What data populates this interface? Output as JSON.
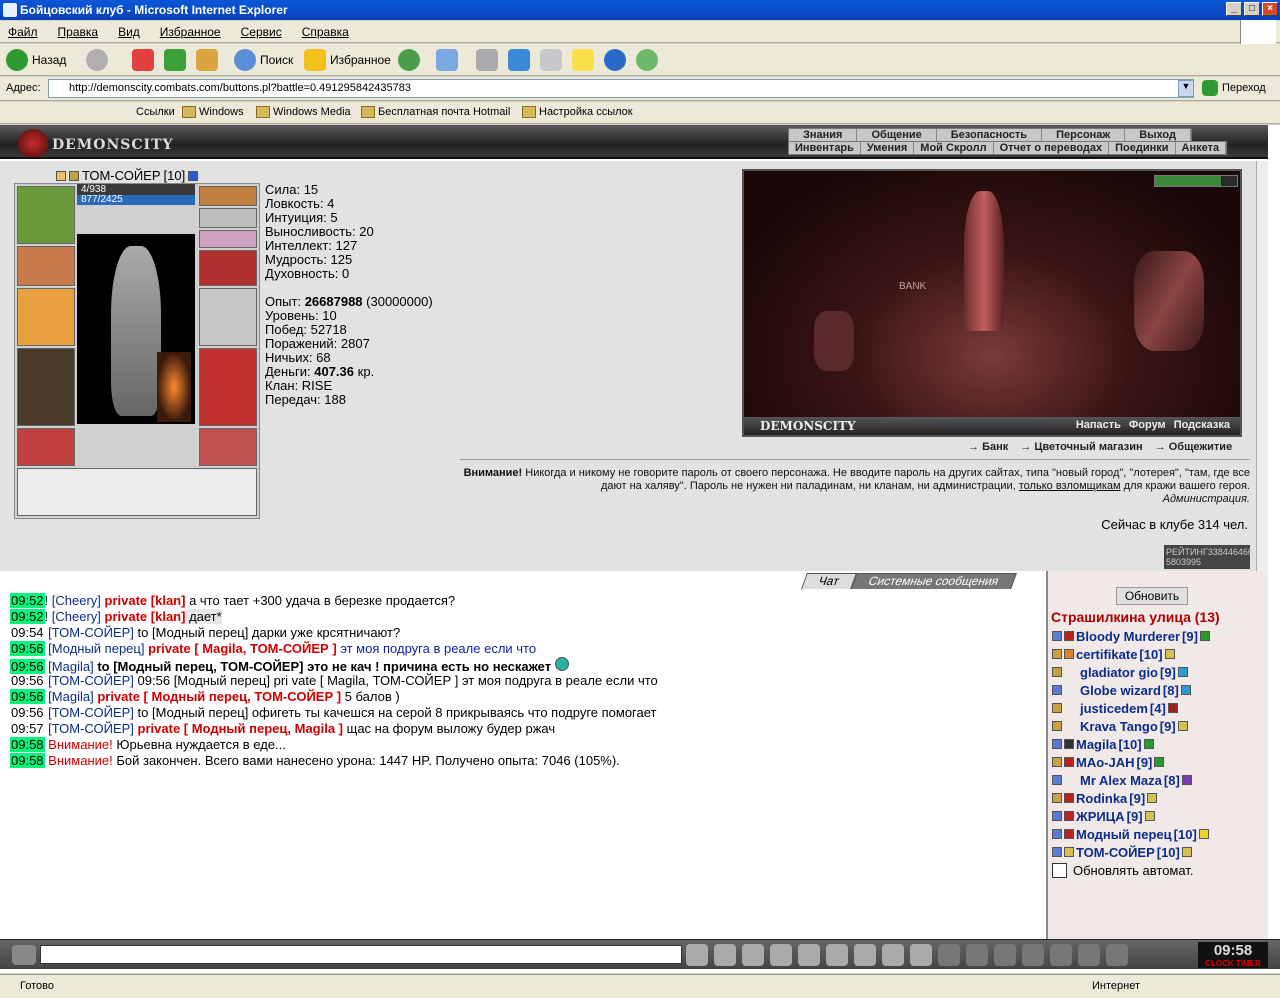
{
  "window": {
    "title": "Бойцовский клуб - Microsoft Internet Explorer"
  },
  "menu": [
    "Файл",
    "Правка",
    "Вид",
    "Избранное",
    "Сервис",
    "Справка"
  ],
  "toolbar": {
    "back": "Назад",
    "search": "Поиск",
    "favorites": "Избранное"
  },
  "address": {
    "label": "Адрес:",
    "url": "http://demonscity.combats.com/buttons.pl?battle=0.491295842435783",
    "go": "Переход"
  },
  "links": {
    "label": "Ссылки",
    "items": [
      "Windows",
      "Windows Media",
      "Бесплатная почта Hotmail",
      "Настройка ссылок"
    ]
  },
  "header": {
    "logo": "DEMONSCITY",
    "nav1": [
      "Знания",
      "Общение",
      "Безопасность",
      "Персонаж",
      "Выход"
    ],
    "nav2": [
      "Инвентарь",
      "Умения",
      "Мой Скролл",
      "Отчет о переводах",
      "Поединки",
      "Анкета"
    ]
  },
  "character": {
    "name": "ТОМ-СОЙЕР",
    "level": "[10]",
    "hp": "4/938",
    "mana": "877/2425"
  },
  "stats": [
    "Сила: 15",
    "Ловкость: 4",
    "Интуиция: 5",
    "Выносливость: 20",
    "Интеллект: 127",
    "Мудрость: 125",
    "Духовность: 0"
  ],
  "progress": {
    "exp_label": "Опыт:",
    "exp": "26687988",
    "exp_next": "(30000000)",
    "level": "Уровень: 10",
    "wins": "Побед: 52718",
    "losses": "Поражений: 2807",
    "draws": "Ничьих: 68",
    "money_label": "Деньги:",
    "money": "407.36",
    "money_unit": "кр.",
    "clan": "Клан: RISE",
    "transfers": "Передач: 188"
  },
  "scene": {
    "bank": "BANK",
    "brand": "DEMONSCITY",
    "actions": [
      "Напасть",
      "Форум",
      "Подсказка"
    ]
  },
  "shops": [
    "Банк",
    "Цветочный магазин",
    "Общежитие"
  ],
  "warning": {
    "bold": "Внимание!",
    "text": "Никогда и никому не говорите пароль от своего персонажа. Не вводите пароль на других сайтах, типа \"новый город\", \"лотерея\", \"там, где все дают на халяву\". Пароль не нужен ни паладинам, ни кланам, ни администрации,",
    "link": "только взломщикам",
    "tail": "для кражи вашего героя.",
    "sign": "Администрация.",
    "online": "Сейчас в клубе 314 чел."
  },
  "rating": {
    "label": "РЕЙТИНГ",
    "value": "338446466",
    "sub": "5803995"
  },
  "chat": {
    "tab_chat": "Чат",
    "tab_system": "Системные сообщения",
    "lines": [
      {
        "t": "09:52",
        "a": "! ",
        "b": "[Cheery]",
        "c": " private [klan]",
        "d": " а что тает +300 удача в березке продается?"
      },
      {
        "t": "09:52",
        "a": "! ",
        "b": "[Cheery]",
        "c": " private [klan]",
        "d": " дает*"
      },
      {
        "t": "09:54",
        "a": "",
        "b": "[ТОМ-СОЙЕР]",
        "c": "",
        "d": " to [Модный перец] дарки уже крсятничают?"
      },
      {
        "t": "09:56",
        "a": "",
        "b": "[Модный перец]",
        "c": " private [ Magila, ТОМ-СОЙЕР ]",
        "d": " эт моя подруга в реале если что"
      },
      {
        "t": "09:56",
        "a": "",
        "b": "[Magila]",
        "c": "",
        "d": " to [Модный перец, ТОМ-СОЙЕР] это не кач ! причина есть но нескажет"
      },
      {
        "t": "09:56",
        "a": "",
        "b": "[ТОМ-СОЙЕР]",
        "c": "",
        "d": " 09:56 [Модный перец] pri vate [ Magila, ТОМ-СОЙЕР ] эт моя подруга в реале если что"
      },
      {
        "t": "09:56",
        "a": "",
        "b": "[Magila]",
        "c": " private [ Модный перец, ТОМ-СОЙЕР ]",
        "d": " 5 балов )"
      },
      {
        "t": "09:56",
        "a": "",
        "b": "[ТОМ-СОЙЕР]",
        "c": "",
        "d": " to [Модный перец] офигеть ты качешся на серой 8 прикрываясь что подруге помогает"
      },
      {
        "t": "09:57",
        "a": "",
        "b": "[ТОМ-СОЙЕР]",
        "c": " private [ Модный перец, Magila ]",
        "d": " щас на форум выложу будер ржач"
      },
      {
        "t": "09:58",
        "a": "",
        "b": "",
        "c": "Внимание!",
        "d": " Юрьевна нуждается в еде..."
      },
      {
        "t": "09:58",
        "a": "",
        "b": "",
        "c": "Внимание!",
        "d": " Бой закончен. Всего вами нанесено урона: 1447 HP. Получено опыта: 7046 (105%)."
      }
    ]
  },
  "room": {
    "refresh": "Обновить",
    "title": "Страшилкина улица (13)",
    "auto": "Обновлять автомат.",
    "users": [
      {
        "n": "Bloody Murderer",
        "l": "[9]"
      },
      {
        "n": "certifikate",
        "l": "[10]"
      },
      {
        "n": "gladiator gio",
        "l": "[9]"
      },
      {
        "n": "Globe wizard",
        "l": "[8]"
      },
      {
        "n": "justicedem",
        "l": "[4]"
      },
      {
        "n": "Krava Tango",
        "l": "[9]"
      },
      {
        "n": "Magila",
        "l": "[10]"
      },
      {
        "n": "MAo-JAH",
        "l": "[9]"
      },
      {
        "n": "Mr Alex Maza",
        "l": "[8]"
      },
      {
        "n": "Rodinka",
        "l": "[9]"
      },
      {
        "n": "ЖРИЦА",
        "l": "[9]"
      },
      {
        "n": "Модный перец",
        "l": "[10]"
      },
      {
        "n": "ТОМ-СОЙЕР",
        "l": "[10]"
      }
    ]
  },
  "clock": {
    "time": "09:58",
    "sub": "CLOCK TIMER"
  },
  "status": {
    "left": "Готово",
    "right": "Интернет"
  }
}
